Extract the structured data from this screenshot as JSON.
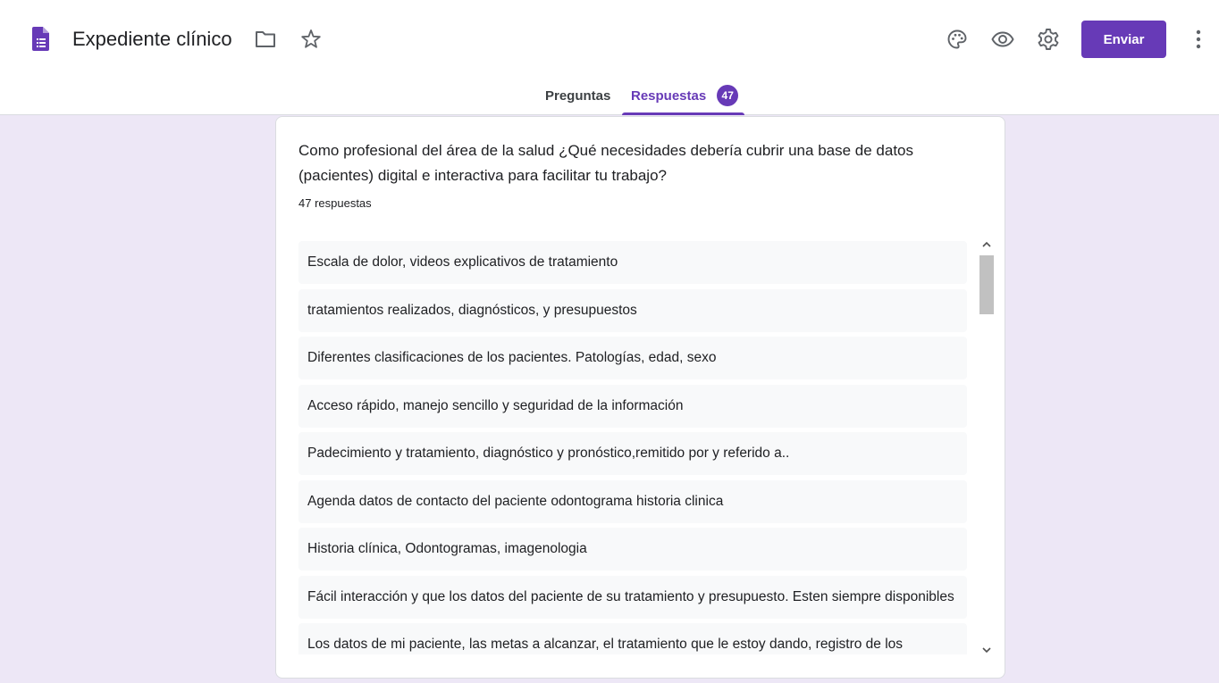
{
  "header": {
    "title": "Expediente clínico",
    "send_label": "Enviar",
    "icons": [
      "forms-doc-icon",
      "folder-icon",
      "star-icon",
      "palette-icon",
      "eye-icon",
      "gear-icon",
      "more-vert-icon"
    ],
    "accent_color": "#673ab7"
  },
  "tabs": {
    "questions_label": "Preguntas",
    "responses_label": "Respuestas",
    "responses_count": "47"
  },
  "question": {
    "text": "Como profesional del área de la salud ¿Qué necesidades debería cubrir una base de datos (pacientes) digital e interactiva para facilitar tu trabajo?",
    "count_label": "47 respuestas"
  },
  "responses": [
    "Escala de dolor, videos explicativos de tratamiento",
    "tratamientos realizados, diagnósticos, y presupuestos",
    "Diferentes clasificaciones de los pacientes. Patologías, edad, sexo",
    "Acceso rápido, manejo sencillo y seguridad de la información",
    "Padecimiento y tratamiento, diagnóstico y pronóstico,remitido por y referido a..",
    "Agenda datos de contacto del paciente odontograma historia clinica",
    "Historia clínica, Odontogramas, imagenologia",
    "Fácil interacción y que los datos del paciente de su tratamiento y presupuesto. Esten siempre disponibles",
    "Los datos de mi paciente, las metas a alcanzar, el tratamiento que le estoy dando, registro de los resultados obtenidos y una herramienta para comparar los resultados obtenidos en cada consulta y poder"
  ]
}
